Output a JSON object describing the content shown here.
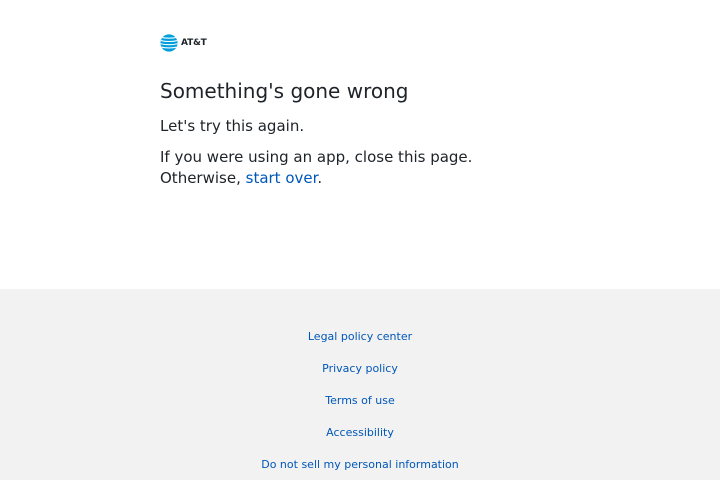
{
  "header": {
    "logo_text": "AT&T",
    "logo_icon": "att-globe-icon",
    "brand_color": "#009fdb"
  },
  "main": {
    "heading": "Something's gone wrong",
    "subtext": "Let's try this again.",
    "instruction_line1": "If you were using an app, close this page.",
    "instruction_prefix": "Otherwise,",
    "start_over_link": "start over",
    "instruction_suffix": "."
  },
  "footer": {
    "background": "#f2f2f2",
    "link_color": "#0057b8",
    "links": [
      "Legal policy center",
      "Privacy policy",
      "Terms of use",
      "Accessibility",
      "Do not sell my personal information"
    ]
  }
}
